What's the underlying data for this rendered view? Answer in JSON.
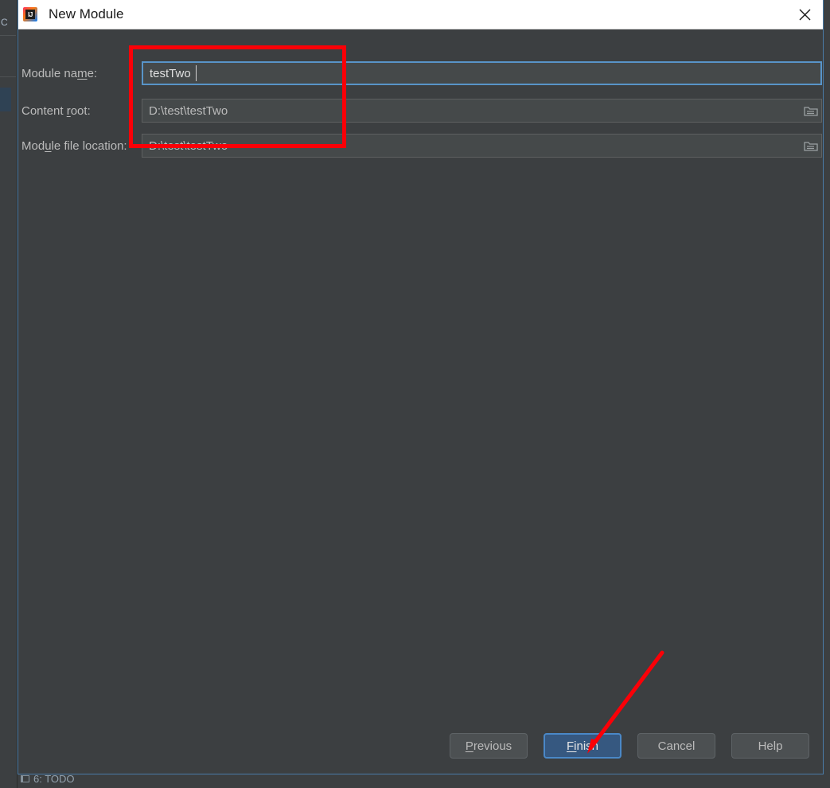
{
  "window": {
    "title": "New Module",
    "app_icon": "intellij-idea-icon",
    "icon_letters": "IJ",
    "close_icon": "close-icon"
  },
  "form": {
    "fields": [
      {
        "id": "module-name",
        "label_before": "Module na",
        "label_mnemonic": "m",
        "label_after": "e:",
        "label_full": "Module name:",
        "value": "testTwo",
        "placeholder": "",
        "focused": true,
        "has_browse": false
      },
      {
        "id": "content-root",
        "label_before": "Content ",
        "label_mnemonic": "r",
        "label_after": "oot:",
        "label_full": "Content root:",
        "value": "D:\\test\\testTwo",
        "placeholder": "",
        "focused": false,
        "has_browse": true,
        "browse_icon": "folder-icon"
      },
      {
        "id": "module-file-location",
        "label_before": "Mod",
        "label_mnemonic": "u",
        "label_after": "le file location:",
        "label_full": "Module file location:",
        "value": "D:\\test\\testTwo",
        "placeholder": "",
        "focused": false,
        "has_browse": true,
        "browse_icon": "folder-icon"
      }
    ]
  },
  "footer": {
    "buttons": [
      {
        "id": "previous",
        "before": "",
        "mnemonic": "P",
        "after": "revious",
        "full": "Previous",
        "primary": false
      },
      {
        "id": "finish",
        "before": "",
        "mnemonic": "Fi",
        "after": "nish",
        "full": "Finish",
        "primary": true
      },
      {
        "id": "cancel",
        "before": "Cancel",
        "mnemonic": "",
        "after": "",
        "full": "Cancel",
        "primary": false
      },
      {
        "id": "help",
        "before": "Help",
        "mnemonic": "",
        "after": "",
        "full": "Help",
        "primary": false
      }
    ]
  },
  "backdrop": {
    "left_strip_label": "C",
    "status_tab_label": "6: TODO"
  },
  "annotations": {
    "highlight_rect_label": "red-rectangle-around-fields",
    "arrow_label": "red-arrow-pointing-to-finish",
    "color": "#fb0007"
  },
  "colors": {
    "dialog_background": "#3c3f41",
    "field_background": "#45494a",
    "primary_button": "#365880",
    "focus_border": "#5894c8",
    "dialog_border": "#4a7ba7",
    "text": "#bbbbbb",
    "titlebar": "#ffffff"
  }
}
